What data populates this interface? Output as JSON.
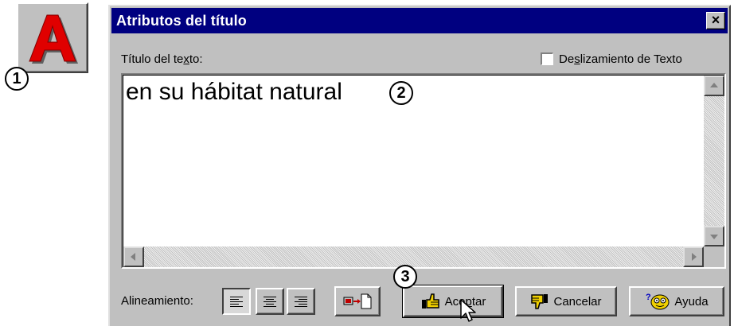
{
  "callouts": [
    "1",
    "2",
    "3"
  ],
  "dialog": {
    "title": "Atributos del título",
    "close_label": "×"
  },
  "field_label": {
    "pre": "Título del te",
    "accel": "x",
    "post": "to:"
  },
  "scroll_checkbox": {
    "pre": "De",
    "accel": "s",
    "post": "lizamiento de Texto",
    "checked": false
  },
  "title_text": "en su hábitat natural",
  "alignment_label": "Alineamiento:",
  "buttons": {
    "accept": {
      "pre": "Ace",
      "accel": "p",
      "post": "tar"
    },
    "cancel": "Cancelar",
    "help": "Ayuda"
  },
  "colors": {
    "titlebar": "#000080",
    "dialog_bg": "#c0c0c0",
    "a_icon": "#e00000"
  },
  "icons": [
    "letter-a-icon",
    "align-left-icon",
    "align-center-icon",
    "align-right-icon",
    "insert-field-icon",
    "thumbs-up-icon",
    "thumbs-down-icon",
    "help-face-icon",
    "mouse-pointer-icon"
  ]
}
